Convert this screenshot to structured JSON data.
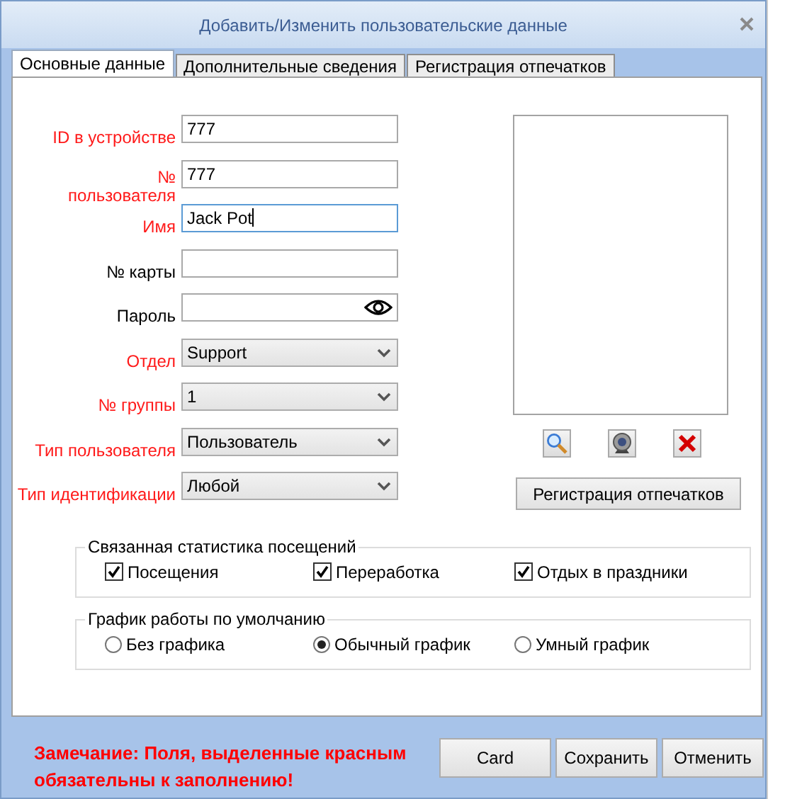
{
  "window": {
    "title": "Добавить/Изменить пользовательские данные"
  },
  "tabs": [
    {
      "label": "Основные данные",
      "selected": true
    },
    {
      "label": "Дополнительные сведения",
      "selected": false
    },
    {
      "label": "Регистрация отпечатков",
      "selected": false
    }
  ],
  "fields": [
    {
      "label": "ID в устройстве",
      "required": true,
      "kind": "text",
      "value": "777",
      "focused": false
    },
    {
      "label": "№ пользователя",
      "required": true,
      "kind": "text",
      "value": "777",
      "focused": false
    },
    {
      "label": "Имя",
      "required": true,
      "kind": "text",
      "value": "Jack Pot",
      "focused": true
    },
    {
      "label": "№ карты",
      "required": false,
      "kind": "text",
      "focused": false
    },
    {
      "label": "Пароль",
      "required": false,
      "kind": "password",
      "focused": false
    },
    {
      "label": "Отдел",
      "required": true,
      "kind": "select",
      "value": "Support",
      "focused": false
    },
    {
      "label": "№ группы",
      "required": true,
      "kind": "select",
      "value": "1",
      "focused": false
    },
    {
      "label": "Тип пользователя",
      "required": true,
      "kind": "select",
      "value": "Пользователь",
      "focused": false
    },
    {
      "label": "Тип идентификации",
      "required": true,
      "kind": "select",
      "value": "Любой",
      "focused": false
    }
  ],
  "photo": {
    "button": "Регистрация отпечатков"
  },
  "attendance": {
    "title": "Связанная статистика посещений",
    "options": [
      {
        "label": "Посещения",
        "checked": true
      },
      {
        "label": "Переработка",
        "checked": true
      },
      {
        "label": "Отдых в праздники",
        "checked": true
      }
    ]
  },
  "schedule": {
    "title": "График работы по умолчанию",
    "options": [
      {
        "label": "Без графика",
        "selected": false
      },
      {
        "label": "Обычный график",
        "selected": true
      },
      {
        "label": "Умный график",
        "selected": false
      }
    ]
  },
  "note_lines": [
    "Замечание: Поля, выделенные красным",
    "обязательны к заполнению!"
  ],
  "buttons": [
    "Card",
    "Сохранить",
    "Отменить"
  ]
}
